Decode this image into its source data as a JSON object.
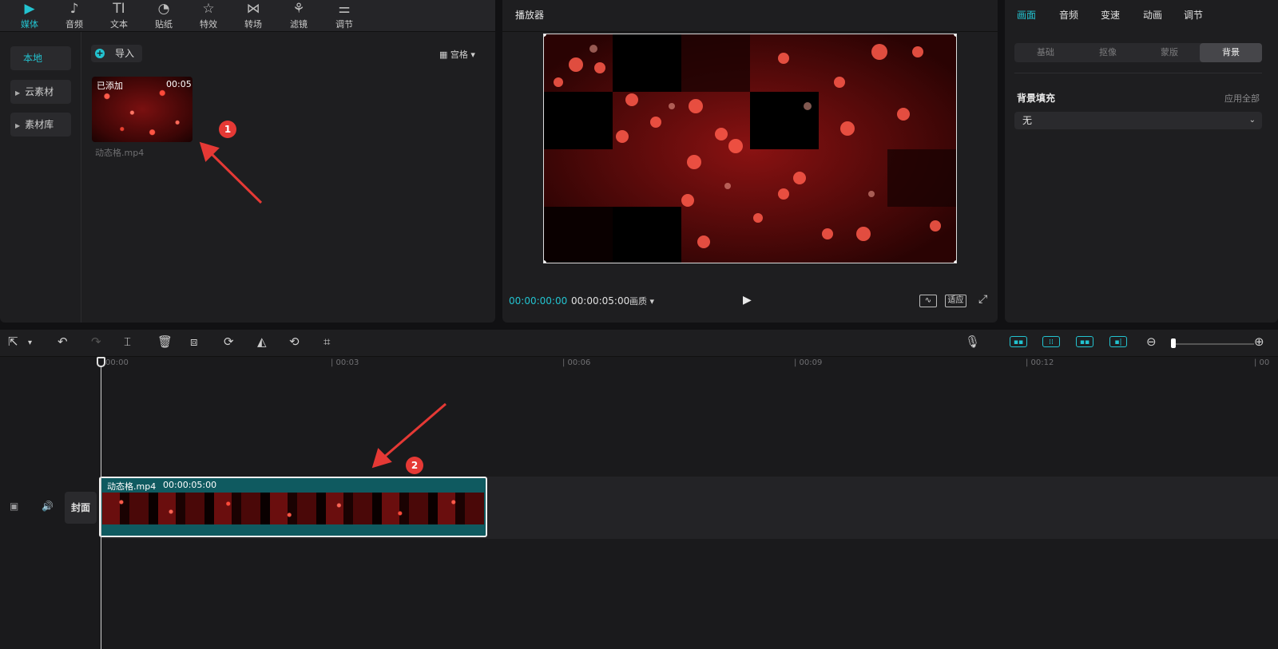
{
  "top_toolbar": {
    "items": [
      {
        "label": "媒体",
        "icon": "media-icon",
        "glyph": "▶"
      },
      {
        "label": "音频",
        "icon": "audio-icon",
        "glyph": "♪"
      },
      {
        "label": "文本",
        "icon": "text-icon",
        "glyph": "TI"
      },
      {
        "label": "贴纸",
        "icon": "sticker-icon",
        "glyph": "◔"
      },
      {
        "label": "特效",
        "icon": "effects-icon",
        "glyph": "☆"
      },
      {
        "label": "转场",
        "icon": "transition-icon",
        "glyph": "⋈"
      },
      {
        "label": "滤镜",
        "icon": "filter-icon",
        "glyph": "⚘"
      },
      {
        "label": "调节",
        "icon": "adjust-icon",
        "glyph": "⚌"
      }
    ]
  },
  "left_nav": {
    "items": [
      {
        "label": "本地"
      },
      {
        "label": "云素材"
      },
      {
        "label": "素材库"
      }
    ]
  },
  "media": {
    "import_label": "导入",
    "view_label": "宫格",
    "thumb_added": "已添加",
    "thumb_duration": "00:05",
    "thumb_name": "动态格.mp4"
  },
  "player": {
    "title": "播放器",
    "time_current": "00:00:00:00",
    "time_total": "00:00:05:00",
    "quality_label": "画质",
    "fit_label": "适应"
  },
  "props": {
    "tabs": [
      {
        "label": "画面"
      },
      {
        "label": "音频"
      },
      {
        "label": "变速"
      },
      {
        "label": "动画"
      },
      {
        "label": "调节"
      }
    ],
    "subtabs": [
      {
        "label": "基础"
      },
      {
        "label": "抠像"
      },
      {
        "label": "蒙版"
      },
      {
        "label": "背景"
      }
    ],
    "bg_fill_label": "背景填充",
    "apply_all_label": "应用全部",
    "fill_value": "无"
  },
  "timeline": {
    "ticks": [
      "00:00",
      "| 00:03",
      "| 00:06",
      "| 00:09",
      "| 00:12",
      "| 00"
    ],
    "cover_label": "封面",
    "clip_name": "动态格.mp4",
    "clip_duration": "00:00:05:00"
  },
  "annotations": {
    "badge1": "1",
    "badge2": "2"
  },
  "colors": {
    "accent": "#23c3d0",
    "annotation": "#e53935",
    "clip": "#0f5a60"
  }
}
